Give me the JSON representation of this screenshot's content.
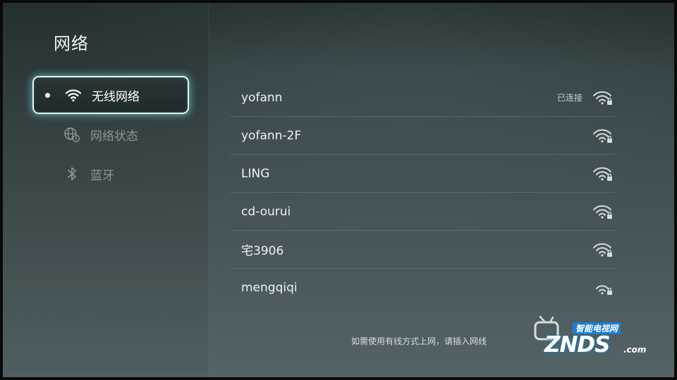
{
  "page": {
    "title": "网络"
  },
  "sidebar": {
    "items": [
      {
        "label": "无线网络",
        "icon": "wifi-icon",
        "active": true
      },
      {
        "label": "网络状态",
        "icon": "globe-info-icon",
        "active": false
      },
      {
        "label": "蓝牙",
        "icon": "bluetooth-icon",
        "active": false
      }
    ]
  },
  "networks": [
    {
      "ssid": "yofann",
      "status": "已连接",
      "signal_icon": "wifi-lock-icon"
    },
    {
      "ssid": "yofann-2F",
      "status": "",
      "signal_icon": "wifi-lock-icon"
    },
    {
      "ssid": "LING",
      "status": "",
      "signal_icon": "wifi-lock-icon"
    },
    {
      "ssid": "cd-ourui",
      "status": "",
      "signal_icon": "wifi-lock-icon"
    },
    {
      "ssid": "宅3906",
      "status": "",
      "signal_icon": "wifi-lock-icon"
    },
    {
      "ssid": "mengqiqi",
      "status": "",
      "signal_icon": "wifi-lock-weak-icon"
    }
  ],
  "hint": "如需使用有线方式上网，请插入网线",
  "watermark": {
    "subtitle": "智能电视网",
    "brand": "ZNDS",
    "suffix": ".com"
  },
  "colors": {
    "focus_glow": "#78e6e6",
    "watermark_blue": "#1b7fd0"
  }
}
